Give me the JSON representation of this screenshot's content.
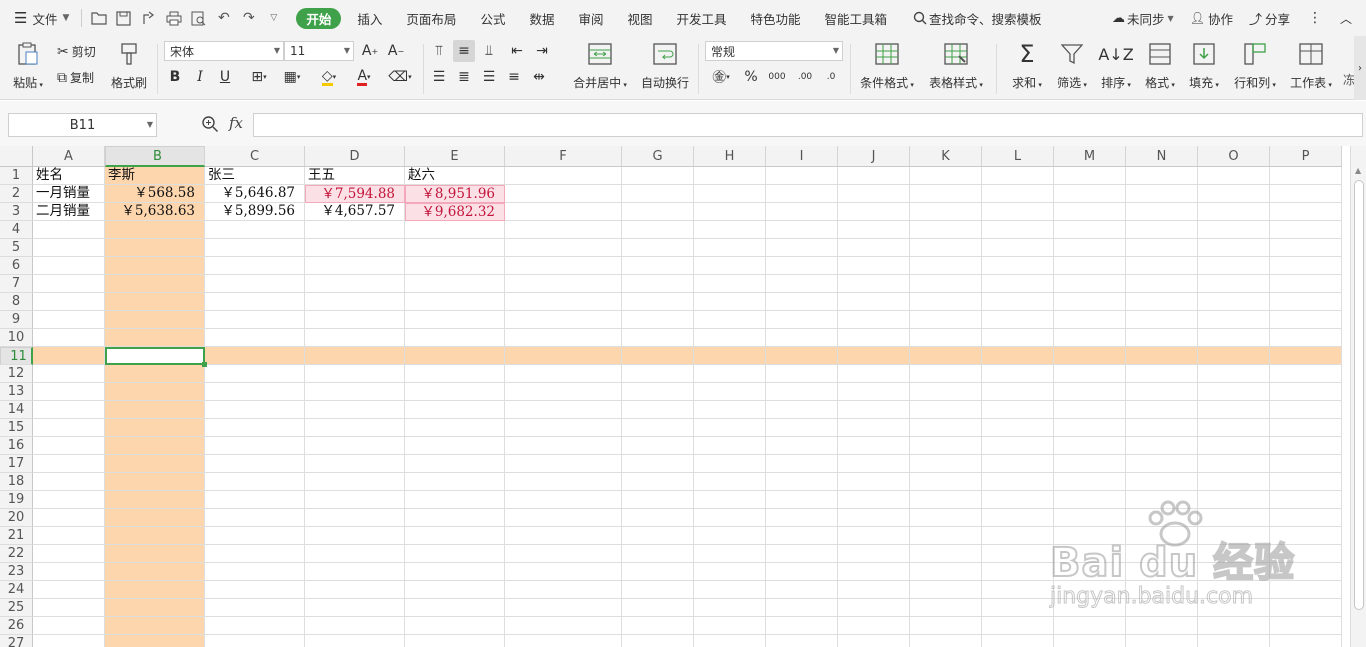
{
  "menu": {
    "file_label": "文件",
    "tabs": [
      "开始",
      "插入",
      "页面布局",
      "公式",
      "数据",
      "审阅",
      "视图",
      "开发工具",
      "特色功能",
      "智能工具箱"
    ],
    "active_tab": "开始",
    "search_placeholder": "查找命令、搜索模板",
    "sync_label": "未同步",
    "collab_label": "协作",
    "share_label": "分享"
  },
  "ribbon": {
    "paste": "粘贴",
    "cut": "剪切",
    "copy": "复制",
    "format_painter": "格式刷",
    "font_name": "宋体",
    "font_size": "11",
    "merge_center": "合并居中",
    "wrap_text": "自动换行",
    "number_format": "常规",
    "cond_format": "条件格式",
    "table_style": "表格样式",
    "sum": "求和",
    "filter": "筛选",
    "sort": "排序",
    "format": "格式",
    "fill": "填充",
    "row_col": "行和列",
    "worksheet": "工作表",
    "freeze_partial": "冻"
  },
  "formula_bar": {
    "name_box": "B11",
    "fx_label": "fx",
    "formula": ""
  },
  "sheet": {
    "columns": [
      "A",
      "B",
      "C",
      "D",
      "E",
      "F",
      "G",
      "H",
      "I",
      "J",
      "K",
      "L",
      "M",
      "N",
      "O",
      "P"
    ],
    "rows": [
      "1",
      "2",
      "3",
      "4",
      "5",
      "6",
      "7",
      "8",
      "9",
      "10",
      "11",
      "12",
      "13",
      "14",
      "15",
      "16",
      "17",
      "18",
      "19",
      "20",
      "21",
      "22",
      "23",
      "24",
      "25",
      "26",
      "27"
    ],
    "selected_column": "B",
    "selected_row": "11",
    "data": [
      [
        "姓名",
        "李斯",
        "张三",
        "王五",
        "赵六"
      ],
      [
        "一月销量",
        "￥568.58",
        "￥5,646.87",
        "￥7,594.88",
        "￥8,951.96"
      ],
      [
        "二月销量",
        "￥5,638.63",
        "￥5,899.56",
        "￥4,657.57",
        "￥9,682.32"
      ]
    ]
  },
  "watermark": {
    "brand": "Bai du 经验",
    "url": "jingyan.baidu.com"
  }
}
